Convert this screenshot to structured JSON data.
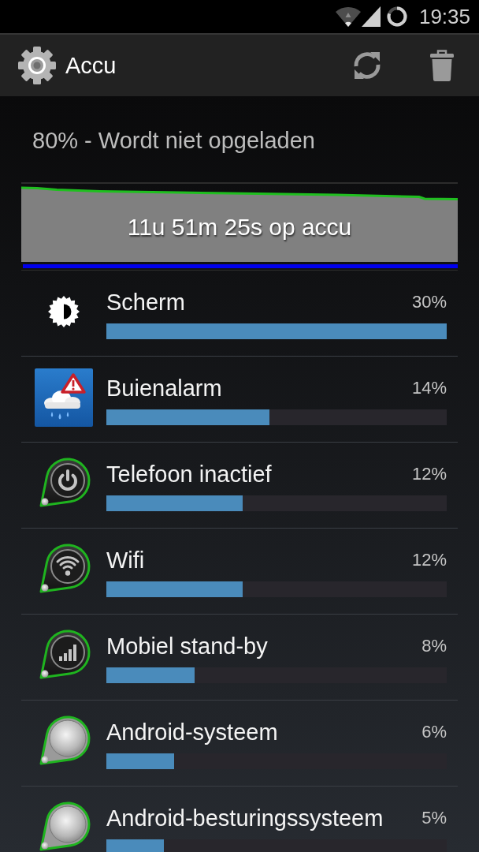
{
  "status_bar": {
    "time": "19:35"
  },
  "action_bar": {
    "title": "Accu"
  },
  "battery": {
    "status": "80% - Wordt niet opgeladen",
    "graph_label": "11u 51m 25s op accu"
  },
  "usage": [
    {
      "kind": "screen",
      "name": "Scherm",
      "percent": "30%",
      "level": 1
    },
    {
      "kind": "weather",
      "name": "Buienalarm",
      "percent": "14%",
      "level": 0.48
    },
    {
      "kind": "power",
      "name": "Telefoon inactief",
      "percent": "12%",
      "level": 0.4
    },
    {
      "kind": "wifi",
      "name": "Wifi",
      "percent": "12%",
      "level": 0.4
    },
    {
      "kind": "cell",
      "name": "Mobiel stand-by",
      "percent": "8%",
      "level": 0.26
    },
    {
      "kind": "system",
      "name": "Android-systeem",
      "percent": "6%",
      "level": 0.2
    },
    {
      "kind": "system",
      "name": "Android-besturingssysteem",
      "percent": "5%",
      "level": 0.17
    }
  ]
}
